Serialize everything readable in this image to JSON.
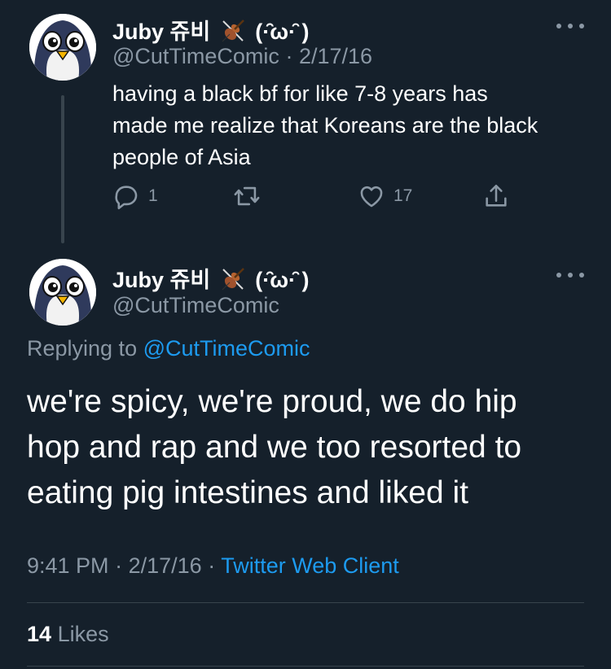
{
  "parent_tweet": {
    "display_name": "Juby 쥬비",
    "kaomoji": "(·̑̑ω·̑ )",
    "handle": "@CutTimeComic",
    "separator": "·",
    "date": "2/17/16",
    "text_lines": [
      "having a black bf for like 7-8 years has",
      "made me realize that Koreans are the black",
      "people of Asia"
    ],
    "reply_count": "1",
    "like_count": "17"
  },
  "reply_tweet": {
    "display_name": "Juby 쥬비",
    "kaomoji": "(·̑̑ω·̑ )",
    "handle": "@CutTimeComic",
    "replying_to_label": "Replying to",
    "replying_to_handle": "@CutTimeComic",
    "text_lines": [
      "we're spicy, we're proud, we do hip",
      "hop and rap and we too resorted to",
      "eating pig intestines and liked it"
    ],
    "time": "9:41 PM",
    "separator": "·",
    "date": "2/17/16",
    "client": "Twitter Web Client",
    "likes_count": "14",
    "likes_label": "Likes"
  },
  "icons": {
    "violin": "violin-emoji",
    "more": "more-dots-icon",
    "reply": "reply-icon",
    "retweet": "retweet-icon",
    "like": "heart-icon",
    "share": "share-icon"
  },
  "colors": {
    "background": "#15202b",
    "text": "#ffffff",
    "secondary": "#8b98a5",
    "link": "#1d9bf0",
    "divider": "#38444d"
  }
}
